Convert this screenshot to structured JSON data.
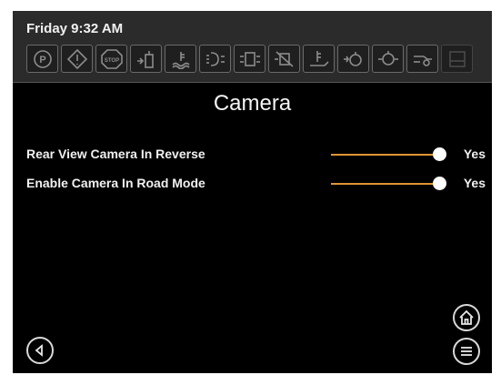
{
  "status_bar": {
    "time": "Friday 9:32 AM",
    "icons": [
      {
        "name": "parking-brake-icon",
        "label": "P",
        "dimmed": false
      },
      {
        "name": "warning-diamond-icon",
        "label": "",
        "dimmed": false
      },
      {
        "name": "stop-icon",
        "label": "STOP",
        "dimmed": false
      },
      {
        "name": "fuel-filter-icon",
        "label": "",
        "dimmed": false
      },
      {
        "name": "coolant-temp-icon",
        "label": "",
        "dimmed": false
      },
      {
        "name": "preheat-icon",
        "label": "",
        "dimmed": false
      },
      {
        "name": "regen-icon",
        "label": "",
        "dimmed": false
      },
      {
        "name": "regen-inhibit-icon",
        "label": "",
        "dimmed": false
      },
      {
        "name": "exhaust-temp-icon",
        "label": "",
        "dimmed": false
      },
      {
        "name": "air-filter-icon",
        "label": "",
        "dimmed": false
      },
      {
        "name": "engine-oil-icon",
        "label": "",
        "dimmed": false
      },
      {
        "name": "hydraulic-oil-icon",
        "label": "",
        "dimmed": false
      },
      {
        "name": "fuel-level-icon",
        "label": "",
        "dimmed": true
      }
    ]
  },
  "page": {
    "title": "Camera"
  },
  "settings": [
    {
      "label": "Rear View Camera In Reverse",
      "value": "Yes",
      "level": 1
    },
    {
      "label": "Enable Camera In Road Mode",
      "value": "Yes",
      "level": 1
    }
  ],
  "nav": {
    "back_icon": "back-arrow-icon",
    "home_icon": "home-icon",
    "menu_icon": "menu-icon"
  },
  "colors": {
    "accent": "#e09533",
    "background": "#000000",
    "header": "#2b2b2b"
  }
}
